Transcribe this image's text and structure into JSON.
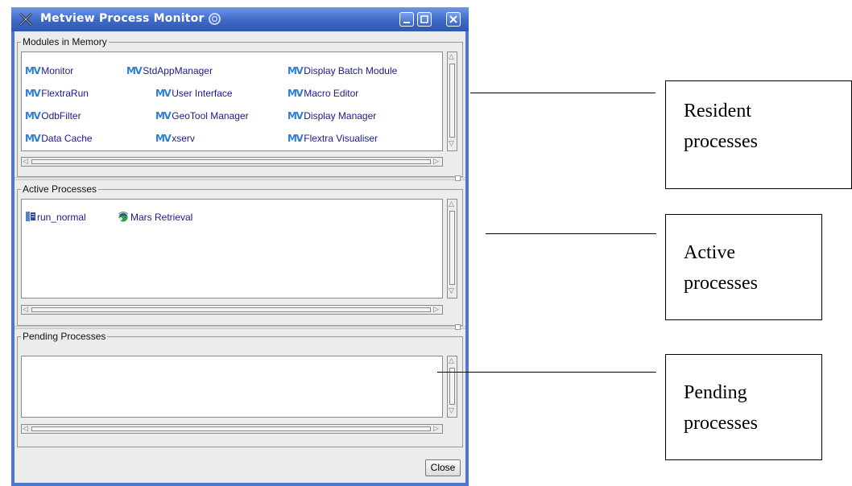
{
  "window": {
    "title": "Metview Process Monitor",
    "close_label": "Close"
  },
  "modules_group": {
    "label": "Modules in Memory",
    "items": [
      {
        "label": "Monitor"
      },
      {
        "label": "StdAppManager"
      },
      {
        "label": "Display Batch Module"
      },
      {
        "label": "FlextraRun"
      },
      {
        "label": "User Interface"
      },
      {
        "label": "Macro Editor"
      },
      {
        "label": "OdbFilter"
      },
      {
        "label": "GeoTool Manager"
      },
      {
        "label": "Display Manager"
      },
      {
        "label": "Data Cache"
      },
      {
        "label": "xserv"
      },
      {
        "label": "Flextra Visualiser"
      }
    ],
    "icon_glyph": "MV"
  },
  "active_group": {
    "label": "Active Processes",
    "items": [
      {
        "label": "run_normal",
        "icon": "script-icon"
      },
      {
        "label": "Mars Retrieval",
        "icon": "mars-globe-icon"
      }
    ]
  },
  "pending_group": {
    "label": "Pending Processes",
    "items": []
  },
  "annotations": {
    "resident": [
      "Resident",
      "processes"
    ],
    "active": [
      "Active",
      "processes"
    ],
    "pending": [
      "Pending",
      "processes"
    ]
  },
  "colors": {
    "titlebar": "#3d69c6",
    "item_text": "#1a1a8a",
    "mv_icon": "#2a7fd4"
  }
}
